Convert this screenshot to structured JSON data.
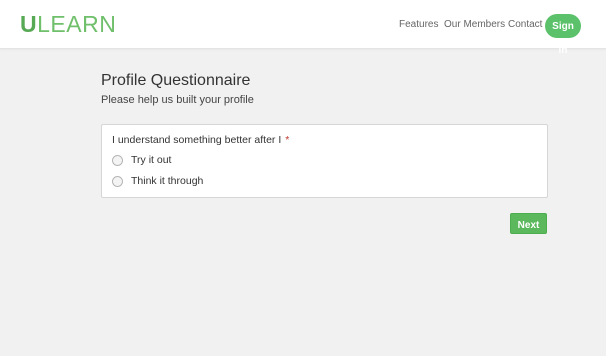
{
  "header": {
    "brand_first": "U",
    "brand_rest": "LEARN",
    "nav": [
      "Features",
      "Our Members",
      "Contact"
    ],
    "signin_label": "Sign in"
  },
  "main": {
    "title": "Profile Questionnaire",
    "subtitle": "Please help us built your profile",
    "question": {
      "text": "I understand something better after I",
      "required_mark": "*",
      "options": [
        "Try it out",
        "Think it through"
      ]
    },
    "next_label": "Next"
  },
  "colors": {
    "brand": "#58a955",
    "accent": "#5cb85c",
    "background": "#f1f1f1"
  }
}
